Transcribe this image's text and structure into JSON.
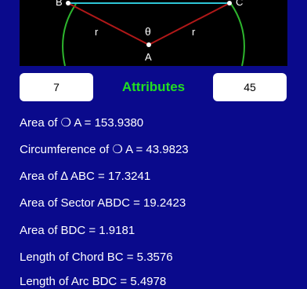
{
  "diagram": {
    "labels": {
      "b": "B",
      "c": "C",
      "r_left": "r",
      "r_right": "r",
      "theta": "θ",
      "a": "A"
    },
    "colors": {
      "chord": "#2ec5d6",
      "radius": "#b01818",
      "arc": "#2db52d"
    }
  },
  "inputs": {
    "left_value": "7",
    "right_value": "45"
  },
  "heading": "Attributes",
  "results": [
    "Area of ❍ A = 153.9380",
    "Circumference of ❍ A = 43.9823",
    "Area of ∆ ABC = 17.3241",
    "Area of Sector ABDC = 19.2423",
    "Area of BDC = 1.9181",
    "Length of Chord BC = 5.3576",
    "Length of Arc BDC = 5.4978"
  ]
}
